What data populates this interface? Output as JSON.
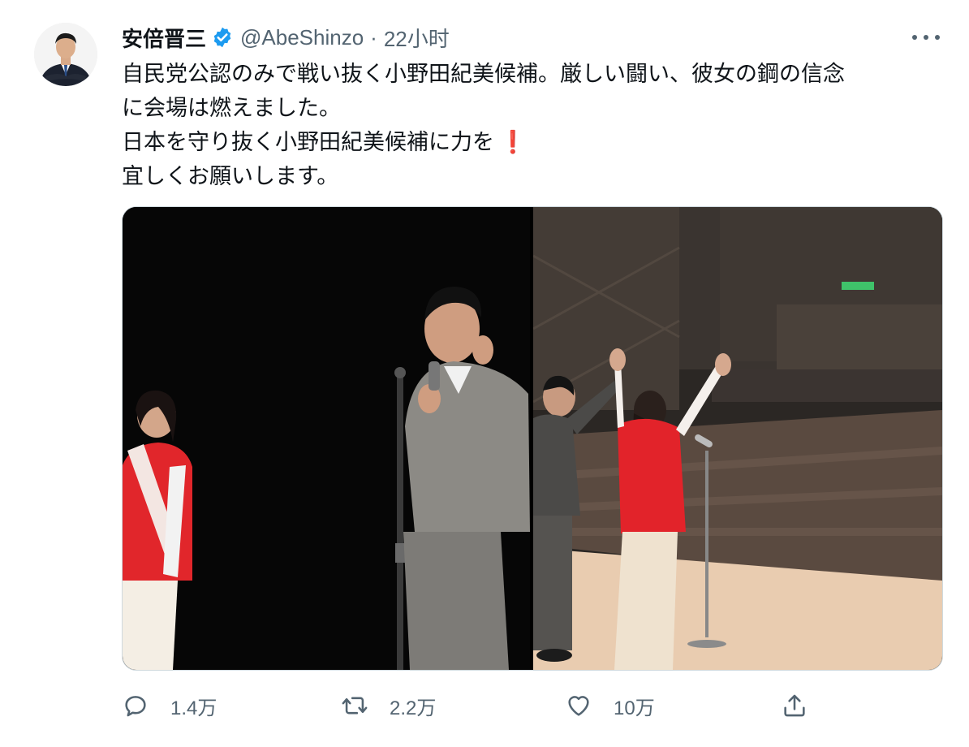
{
  "tweet": {
    "author_name": "安倍晋三",
    "handle": "@AbeShinzo",
    "separator": "·",
    "time": "22小时",
    "text_lines": [
      "自民党公認のみで戦い抜く小野田紀美候補。厳しい闘い、彼女の鋼の信念",
      "に会場は燃えました。",
      "日本を守り抜く小野田紀美候補に力を",
      "宜しくお願いします。"
    ],
    "exclamation": "❗",
    "actions": {
      "reply_count": "1.4万",
      "retweet_count": "2.2万",
      "like_count": "10万"
    }
  },
  "icons": {
    "verified": "verified-badge-icon",
    "more": "more-options-icon",
    "reply": "reply-icon",
    "retweet": "retweet-icon",
    "like": "heart-icon",
    "share": "share-icon"
  },
  "colors": {
    "verified_blue": "#1d9bf0",
    "secondary_text": "#536471",
    "candidate_red": "#e02a2a"
  }
}
